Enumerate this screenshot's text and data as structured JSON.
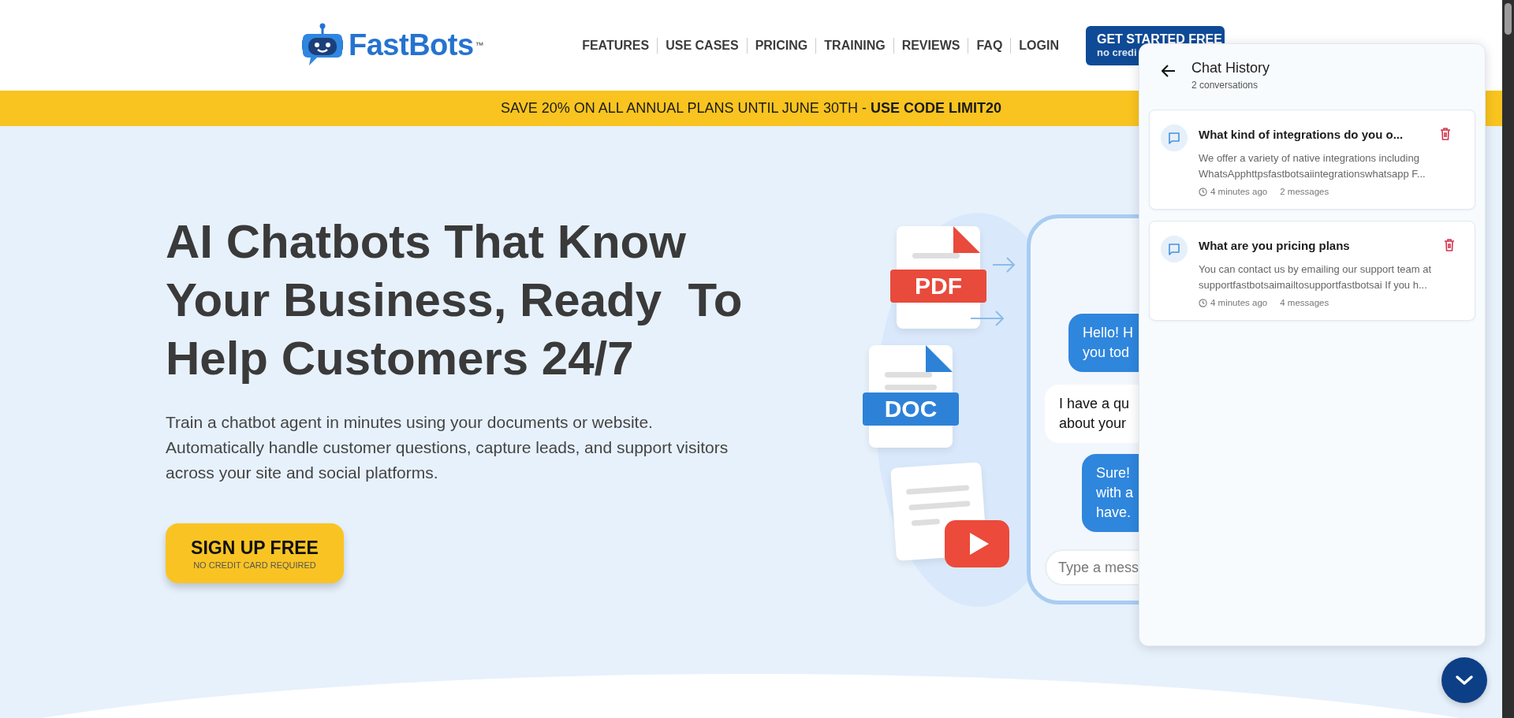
{
  "header": {
    "logo": {
      "text": "FastBots",
      "mark": "™"
    },
    "nav": [
      {
        "label": "FEATURES"
      },
      {
        "label": "USE CASES"
      },
      {
        "label": "PRICING"
      },
      {
        "label": "TRAINING"
      },
      {
        "label": "REVIEWS"
      },
      {
        "label": "FAQ"
      },
      {
        "label": "LOGIN"
      }
    ],
    "cta": {
      "label": "GET STARTED FREE",
      "sub": "no credi"
    }
  },
  "banner": {
    "text": "SAVE 20% ON ALL ANNUAL PLANS UNTIL JUNE 30TH - **USE CODE LIMIT20**"
  },
  "hero": {
    "heading_lines": [
      "AI Chatbots That Know",
      "Your Business, Ready  To",
      "Help Customers 24/7"
    ],
    "description": "Train a chatbot agent in minutes using your documents or website. Automatically handle customer questions, capture leads, and support visitors across your site and social platforms.",
    "button": {
      "label": "SIGN UP FREE",
      "sub": "NO CREDIT CARD REQUIRED"
    }
  },
  "illustration": {
    "files": [
      {
        "kind": "pdf",
        "label": "PDF"
      },
      {
        "kind": "doc",
        "label": "DOC"
      },
      {
        "kind": "video"
      }
    ],
    "messages": [
      {
        "kind": "bot",
        "lines": [
          "Hello! H",
          "you tod"
        ]
      },
      {
        "kind": "user",
        "lines": [
          "I have a qu",
          "about your"
        ]
      },
      {
        "kind": "bot",
        "lines": [
          "Sure!",
          "with a",
          "have."
        ]
      }
    ],
    "input": {
      "placeholder": "Type a mess"
    }
  },
  "chat_history": {
    "title": "Chat History",
    "subtitle": "2 conversations",
    "conversations": [
      {
        "title": "What kind of integrations do you o...",
        "preview_lines": [
          "We offer a variety of native integrations including",
          "WhatsApphttpsfastbotsaiintegrationswhatsapp F..."
        ],
        "time": "4 minutes ago",
        "count": "2 messages"
      },
      {
        "title": "What are you pricing plans",
        "preview_lines": [
          "You can contact us by emailing our support team at",
          "supportfastbotsaimailtosupportfastbotsai If you h..."
        ],
        "time": "4 minutes ago",
        "count": "4 messages"
      }
    ]
  }
}
